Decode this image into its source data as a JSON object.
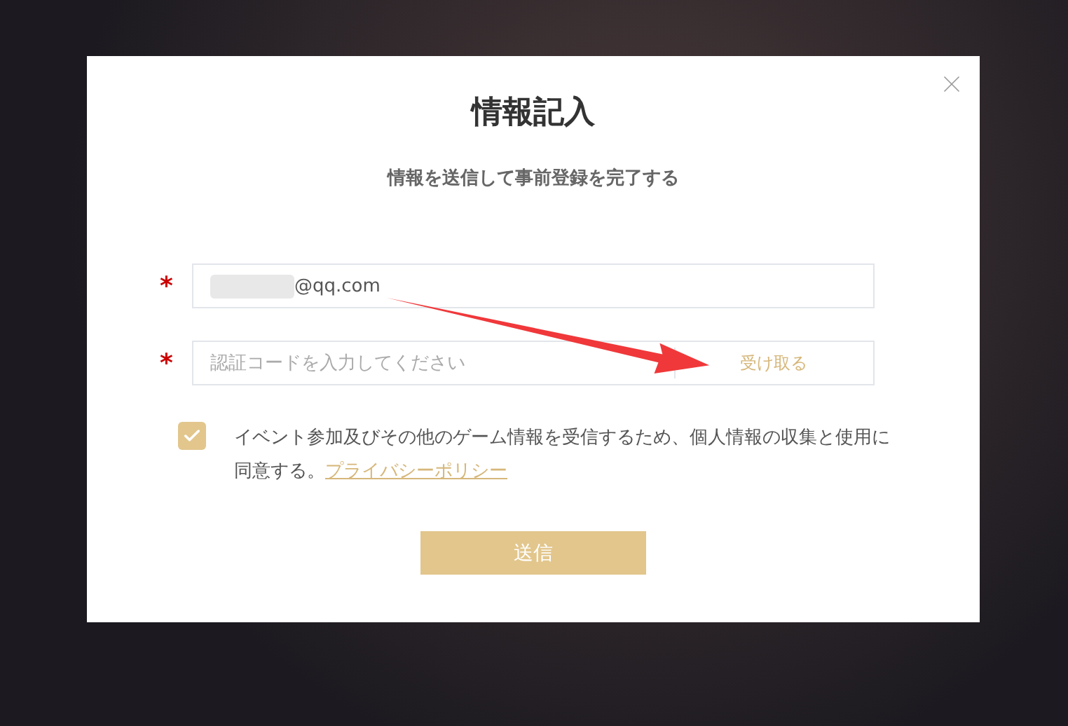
{
  "dialog": {
    "title": "情報記入",
    "subtitle": "情報を送信して事前登録を完了する"
  },
  "fields": [
    {
      "kind": "email",
      "required_mark": "*",
      "value": "@qq.com",
      "redacted": true
    },
    {
      "kind": "code",
      "required_mark": "*",
      "placeholder": "認証コードを入力してください",
      "action": "受け取る"
    }
  ],
  "consent": {
    "checked": true,
    "text": "イベント参加及びその他のゲーム情報を受信するため、個人情報の収集と使用に同意する。",
    "link": "プライバシーポリシー"
  },
  "submit": "送信"
}
